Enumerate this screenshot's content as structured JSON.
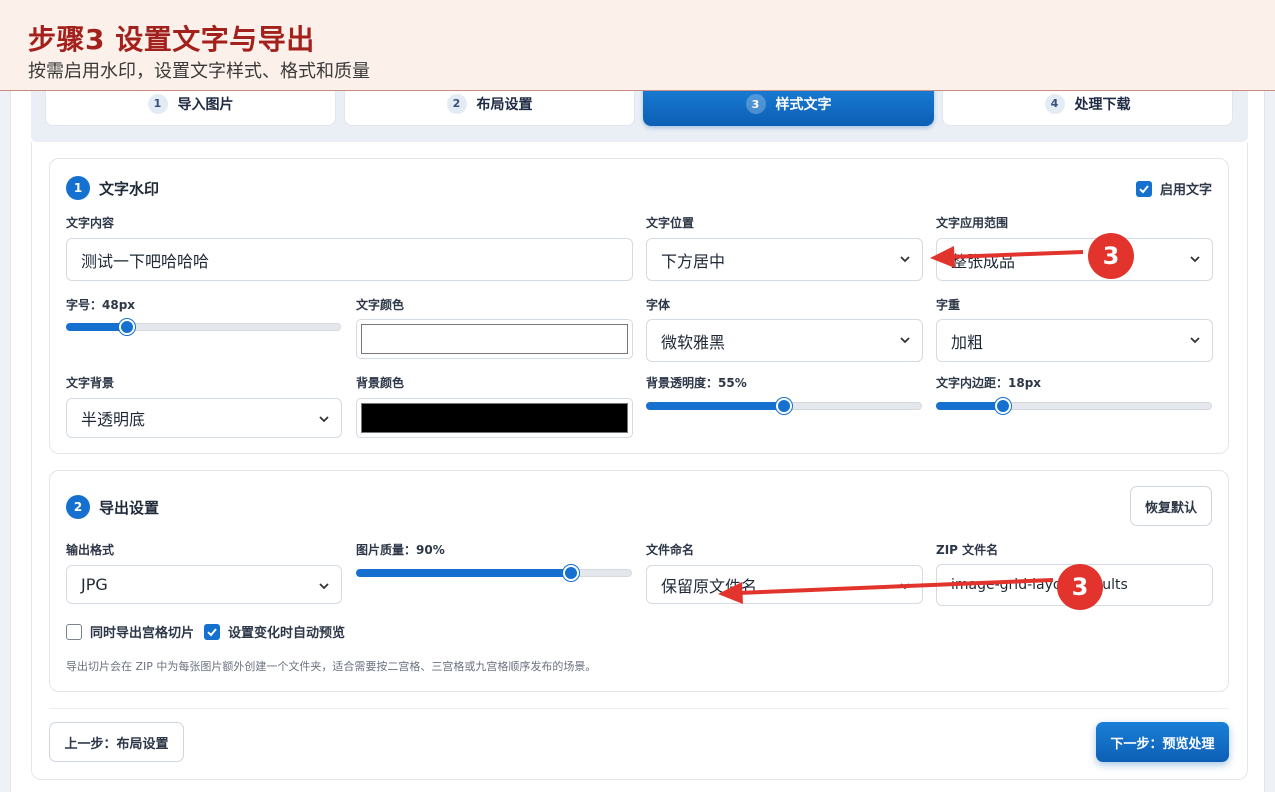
{
  "banner": {
    "title": "步骤3 设置文字与导出",
    "subtitle": "按需启用水印，设置文字样式、格式和质量"
  },
  "wizard": {
    "steps": [
      {
        "num": "1",
        "label": "导入图片",
        "active": false
      },
      {
        "num": "2",
        "label": "布局设置",
        "active": false
      },
      {
        "num": "3",
        "label": "样式文字",
        "active": true
      },
      {
        "num": "4",
        "label": "处理下载",
        "active": false
      }
    ]
  },
  "watermark": {
    "badge": "1",
    "title": "文字水印",
    "enable_label": "启用文字",
    "enable_checked": true,
    "text_content_label": "文字内容",
    "text_content_value": "测试一下吧哈哈哈",
    "position_label": "文字位置",
    "position_value": "下方居中",
    "scope_label": "文字应用范围",
    "scope_value": "整张成品",
    "font_size_label": "字号：48px",
    "font_size_fraction": 0.22,
    "text_color_label": "文字颜色",
    "text_color": "#ffffff",
    "font_label": "字体",
    "font_value": "微软雅黑",
    "weight_label": "字重",
    "weight_value": "加粗",
    "bg_label": "文字背景",
    "bg_value": "半透明底",
    "bg_color_label": "背景颜色",
    "bg_color": "#000000",
    "bg_opacity_label": "背景透明度：55%",
    "bg_opacity_fraction": 0.5,
    "padding_label": "文字内边距：18px",
    "padding_fraction": 0.24
  },
  "export": {
    "badge": "2",
    "title": "导出设置",
    "reset_label": "恢复默认",
    "format_label": "输出格式",
    "format_value": "JPG",
    "quality_label": "图片质量：90%",
    "quality_fraction": 0.78,
    "naming_label": "文件命名",
    "naming_value": "保留原文件名",
    "zip_label": "ZIP 文件名",
    "zip_value": "image-grid-layout-results",
    "slice_label": "同时导出宫格切片",
    "slice_checked": false,
    "autopreview_label": "设置变化时自动预览",
    "autopreview_checked": true,
    "hint": "导出切片会在 ZIP 中为每张图片额外创建一个文件夹，适合需要按二宫格、三宫格或九宫格顺序发布的场景。"
  },
  "footer": {
    "prev_label": "上一步：布局设置",
    "next_label": "下一步：预览处理"
  },
  "annotations": {
    "marker_label": "3",
    "accent": "#e2332c"
  }
}
